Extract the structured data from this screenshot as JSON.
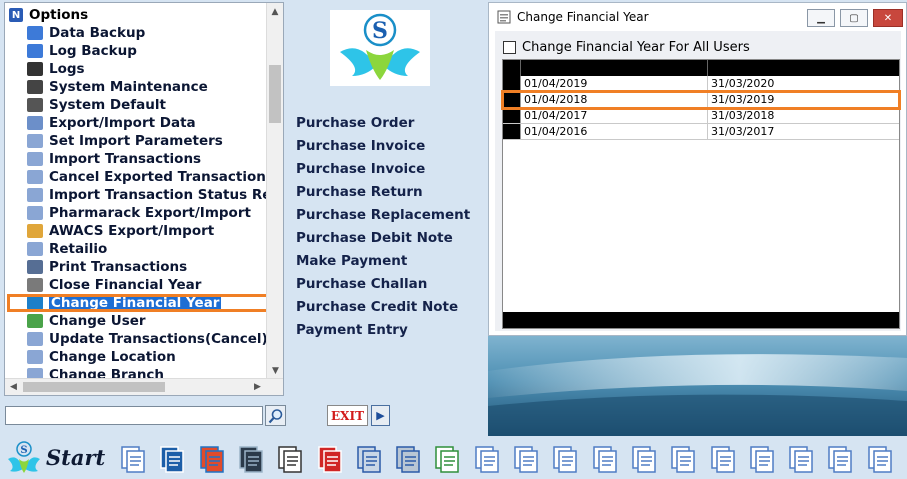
{
  "tree": {
    "root_label": "Options",
    "items": [
      {
        "label": "Data Backup",
        "icon": "data-backup-icon",
        "color": "#3d7ad8"
      },
      {
        "label": "Log Backup",
        "icon": "log-backup-icon",
        "color": "#3d7ad8"
      },
      {
        "label": "Logs",
        "icon": "logs-icon",
        "color": "#333333"
      },
      {
        "label": "System Maintenance",
        "icon": "system-maintenance-icon",
        "color": "#444444"
      },
      {
        "label": "System Default",
        "icon": "system-default-icon",
        "color": "#555555"
      },
      {
        "label": "Export/Import Data",
        "icon": "export-import-icon",
        "color": "#6c8fc9"
      },
      {
        "label": "Set Import Parameters",
        "icon": "document-icon",
        "color": "#8aa6d4"
      },
      {
        "label": "Import Transactions",
        "icon": "document-icon",
        "color": "#8aa6d4"
      },
      {
        "label": "Cancel Exported Transactions",
        "icon": "document-icon",
        "color": "#8aa6d4"
      },
      {
        "label": "Import Transaction Status Rep",
        "icon": "document-icon",
        "color": "#8aa6d4"
      },
      {
        "label": "Pharmarack Export/Import",
        "icon": "document-icon",
        "color": "#8aa6d4"
      },
      {
        "label": "AWACS Export/Import",
        "icon": "awacs-icon",
        "color": "#e0a63a"
      },
      {
        "label": "Retailio",
        "icon": "document-icon",
        "color": "#8aa6d4"
      },
      {
        "label": "Print Transactions",
        "icon": "printer-icon",
        "color": "#566e94"
      },
      {
        "label": "Close Financial Year",
        "icon": "calendar-icon",
        "color": "#7a7a7a"
      },
      {
        "label": "Change Financial Year",
        "icon": "change-year-icon",
        "color": "#1d7fc9"
      },
      {
        "label": "Change User",
        "icon": "change-user-icon",
        "color": "#4aa34a"
      },
      {
        "label": "Update Transactions(Cancel)",
        "icon": "document-icon",
        "color": "#8aa6d4"
      },
      {
        "label": "Change Location",
        "icon": "document-icon",
        "color": "#8aa6d4"
      },
      {
        "label": "Change Branch",
        "icon": "document-icon",
        "color": "#8aa6d4"
      }
    ]
  },
  "exit_label": "EXIT",
  "menu": [
    "Purchase Order",
    "Purchase Invoice",
    "Purchase Invoice",
    "Purchase Return",
    "Purchase Replacement",
    "Purchase Debit Note",
    "Make Payment",
    "Purchase Challan",
    "Purchase Credit Note",
    "Payment Entry"
  ],
  "dialog": {
    "title": "Change Financial Year",
    "checkbox_label": "Change Financial Year For All Users",
    "years": [
      {
        "from": "01/04/2019",
        "to": "31/03/2020"
      },
      {
        "from": "01/04/2018",
        "to": "31/03/2019"
      },
      {
        "from": "01/04/2017",
        "to": "31/03/2018"
      },
      {
        "from": "01/04/2016",
        "to": "31/03/2017"
      }
    ],
    "selected_index": 1
  },
  "taskbar": {
    "start_label": "Start",
    "icons": [
      "app-logo-icon",
      "doc-icon",
      "mp-icon",
      "shapes-icon",
      "phone-icon",
      "journal-icon",
      "bookmark-icon",
      "printer-icon",
      "s-icon",
      "re-icon",
      "doc-icon",
      "doc-icon",
      "doc-icon",
      "doc-icon",
      "doc-icon",
      "doc-icon",
      "doc-icon",
      "doc-icon",
      "doc-icon",
      "doc-icon",
      "doc-icon",
      "doc-icon"
    ]
  },
  "colors": {
    "highlight": "#f07f25",
    "selection": "#1e6ed3",
    "background": "#d6e4f2"
  }
}
